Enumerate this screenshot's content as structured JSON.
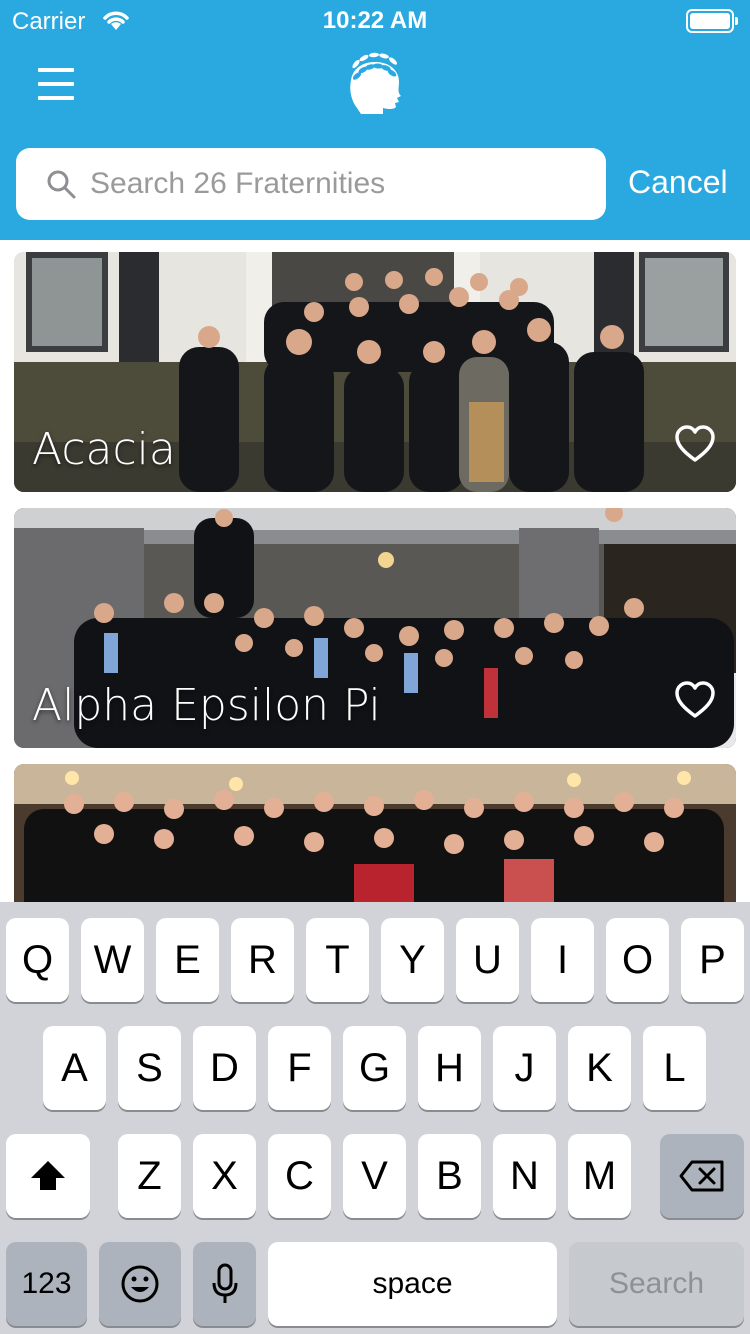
{
  "status_bar": {
    "carrier": "Carrier",
    "time": "10:22 AM"
  },
  "header": {
    "logo_icon": "caesar-head-logo-icon",
    "menu_icon": "hamburger-menu-icon"
  },
  "search": {
    "placeholder": "Search 26 Fraternities",
    "value": "",
    "cancel_label": "Cancel"
  },
  "fraternities": [
    {
      "name": "Acacia",
      "favorite": false
    },
    {
      "name": "Alpha Epsilon Pi",
      "favorite": false
    },
    {
      "name": "",
      "favorite": false
    }
  ],
  "keyboard": {
    "row1": [
      "Q",
      "W",
      "E",
      "R",
      "T",
      "Y",
      "U",
      "I",
      "O",
      "P"
    ],
    "row2": [
      "A",
      "S",
      "D",
      "F",
      "G",
      "H",
      "J",
      "K",
      "L"
    ],
    "row3": [
      "Z",
      "X",
      "C",
      "V",
      "B",
      "N",
      "M"
    ],
    "numbers_label": "123",
    "space_label": "space",
    "return_label": "Search"
  },
  "colors": {
    "accent": "#2aa9e0",
    "keyboard_bg": "#d1d3d9"
  }
}
